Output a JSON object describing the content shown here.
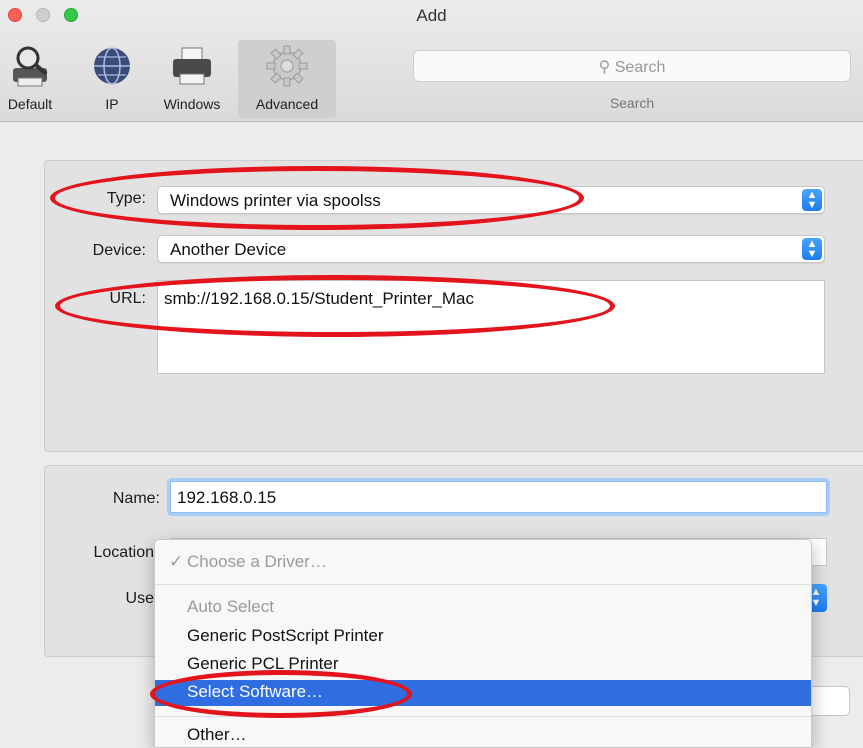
{
  "window": {
    "title": "Add"
  },
  "toolbar": {
    "buttons": [
      {
        "label": "Default",
        "icon": "magnifier-printer-icon"
      },
      {
        "label": "IP",
        "icon": "globe-icon"
      },
      {
        "label": "Windows",
        "icon": "printer-icon"
      },
      {
        "label": "Advanced",
        "icon": "gear-icon"
      }
    ],
    "active_tab": "Advanced"
  },
  "search": {
    "placeholder": "Search",
    "caption": "Search"
  },
  "connection": {
    "type_label": "Type:",
    "type_value": "Windows printer via spoolss",
    "device_label": "Device:",
    "device_value": "Another Device",
    "url_label": "URL:",
    "url_value": "smb://192.168.0.15/Student_Printer_Mac"
  },
  "details": {
    "name_label": "Name:",
    "name_value": "192.168.0.15",
    "location_label": "Location",
    "use_label": "Use"
  },
  "driver_menu": {
    "header": "Choose a Driver…",
    "header_check": "✓",
    "items": [
      {
        "label": "Auto Select",
        "state": "disabled"
      },
      {
        "label": "Generic PostScript Printer",
        "state": "normal"
      },
      {
        "label": "Generic PCL Printer",
        "state": "normal"
      },
      {
        "label": "Select Software…",
        "state": "highlighted"
      },
      {
        "label": "Other…",
        "state": "normal"
      }
    ]
  },
  "colors": {
    "highlight": "#2f6de1",
    "annotation": "#e3141c",
    "accent_blue": "#1c7cf0"
  }
}
